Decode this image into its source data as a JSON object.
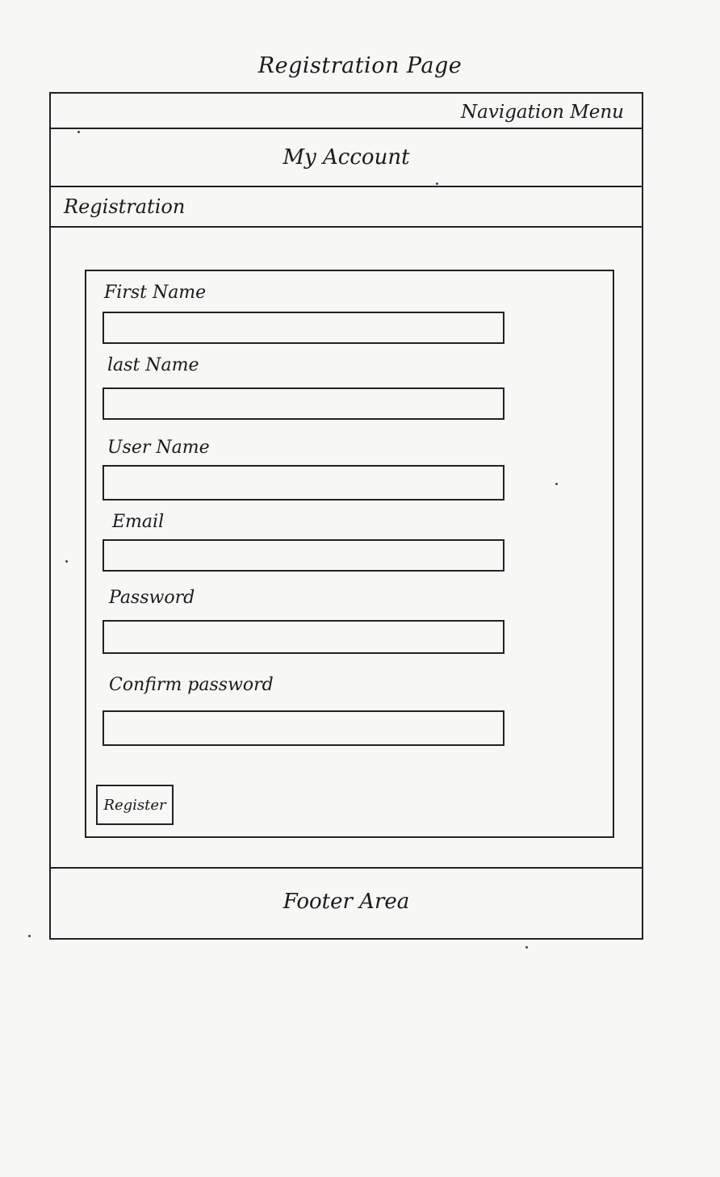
{
  "page_title": "Registration Page",
  "nav": {
    "menu_label": "Navigation Menu"
  },
  "header": {
    "title": "My Account"
  },
  "section": {
    "title": "Registration"
  },
  "form": {
    "fields": [
      {
        "label": "First Name",
        "value": "",
        "placeholder": ""
      },
      {
        "label": "last Name",
        "value": "",
        "placeholder": ""
      },
      {
        "label": "User Name",
        "value": "",
        "placeholder": ""
      },
      {
        "label": "Email",
        "value": "",
        "placeholder": ""
      },
      {
        "label": "Password",
        "value": "",
        "placeholder": ""
      },
      {
        "label": "Confirm password",
        "value": "",
        "placeholder": ""
      }
    ],
    "submit_label": "Register"
  },
  "footer": {
    "label": "Footer Area"
  }
}
